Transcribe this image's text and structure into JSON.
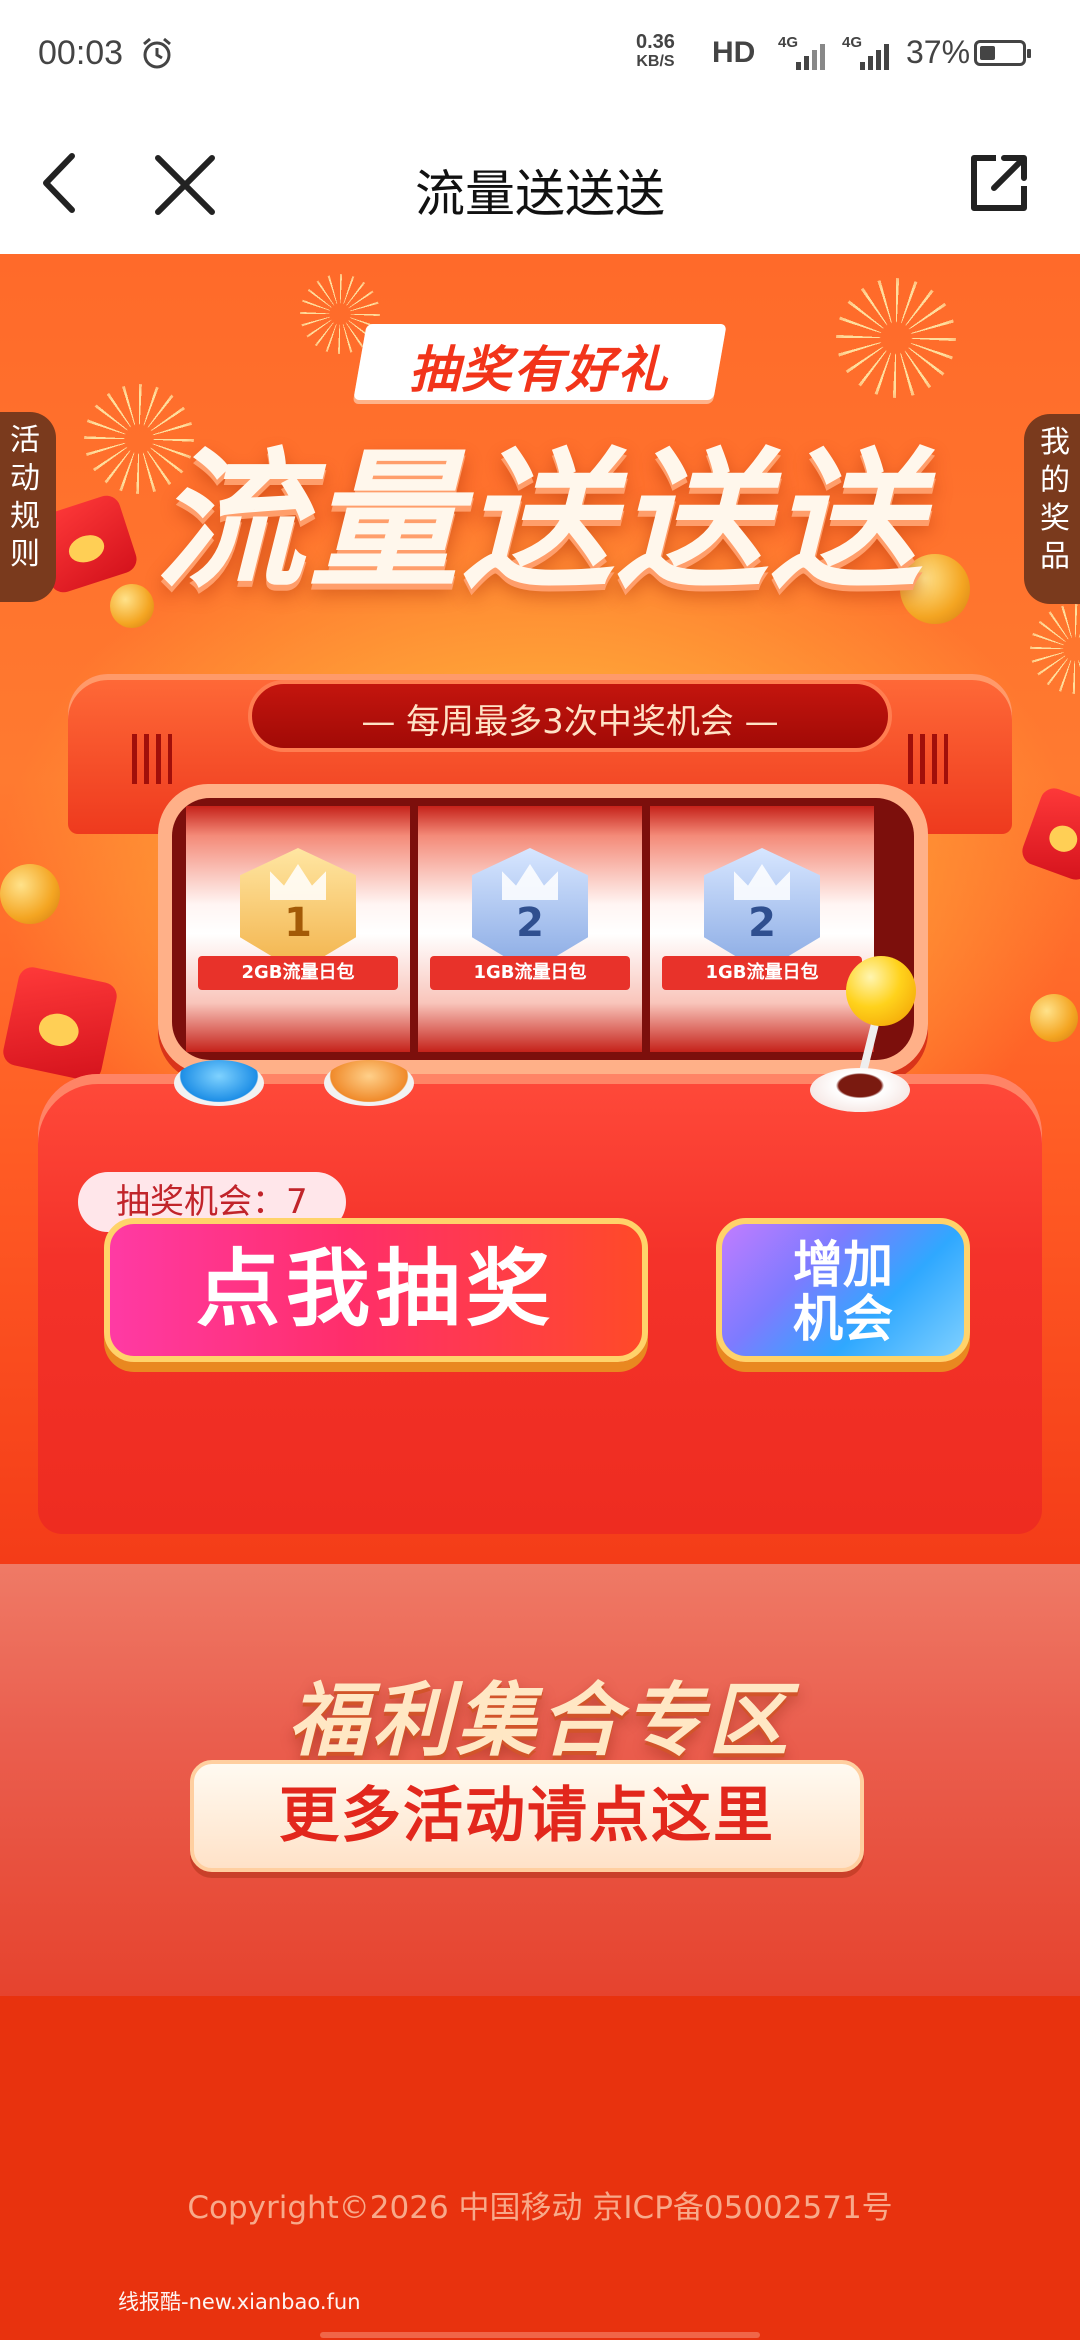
{
  "status_bar": {
    "time": "00:03",
    "net_speed_value": "0.36",
    "net_speed_unit": "KB/S",
    "hd_label": "HD",
    "signal_label": "4G",
    "battery_percent": "37%",
    "battery_level": 0.37
  },
  "nav": {
    "title": "流量送送送",
    "back_icon": "chevron-left-icon",
    "close_icon": "close-icon",
    "share_icon": "share-icon"
  },
  "hero": {
    "badge": "抽奖有好礼",
    "title": "流量送送送",
    "rules_tab": "活动规则",
    "prizes_tab": "我的奖品",
    "machine_banner": "— 每周最多3次中奖机会 —",
    "reels": [
      {
        "rank": "1",
        "label": "2GB流量日包",
        "style": "gold"
      },
      {
        "rank": "2",
        "label": "1GB流量日包",
        "style": "blue"
      },
      {
        "rank": "2",
        "label": "1GB流量日包",
        "style": "blue"
      }
    ],
    "chances_text": "抽奖机会：7",
    "draw_button": "点我抽奖",
    "more_chances_line1": "增加",
    "more_chances_line2": "机会"
  },
  "welfare": {
    "title": "福利集合专区",
    "button": "更多活动请点这里"
  },
  "footer": {
    "copyright": "Copyright©2026 中国移动 京ICP备05002571号",
    "watermark": "线报酷-new.xianbao.fun"
  },
  "colors": {
    "accent": "#ff5a24",
    "deep_red": "#e8320e",
    "gold": "#ffd36a"
  }
}
